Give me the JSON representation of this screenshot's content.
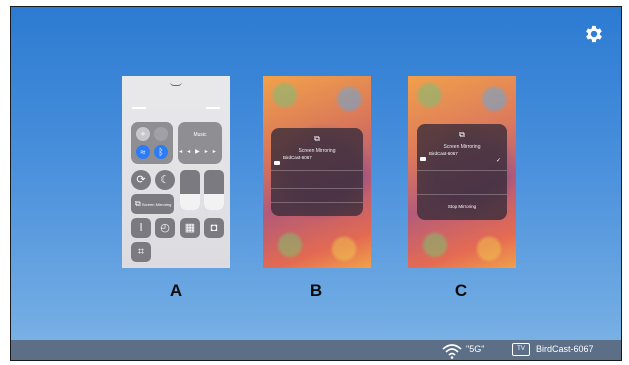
{
  "settings": {
    "icon": "gear-icon"
  },
  "panels": [
    {
      "label": "A"
    },
    {
      "label": "B"
    },
    {
      "label": "C"
    }
  ],
  "panelA": {
    "music_label": "Music",
    "mirroring_label": "Screen Mirroring"
  },
  "panelB": {
    "title": "Screen Mirroring",
    "device": "BirdCast-6067"
  },
  "panelC": {
    "title": "Screen Mirroring",
    "device": "BirdCast-6067",
    "check": "✓",
    "stop": "Stop Mirroring"
  },
  "status_bar": {
    "wifi_label": "\"5G\"",
    "device_label": "BirdCast-6067",
    "tv_badge": "TV"
  },
  "colors": {
    "background": "#3f8ad8",
    "bar": "#5d6f86"
  }
}
